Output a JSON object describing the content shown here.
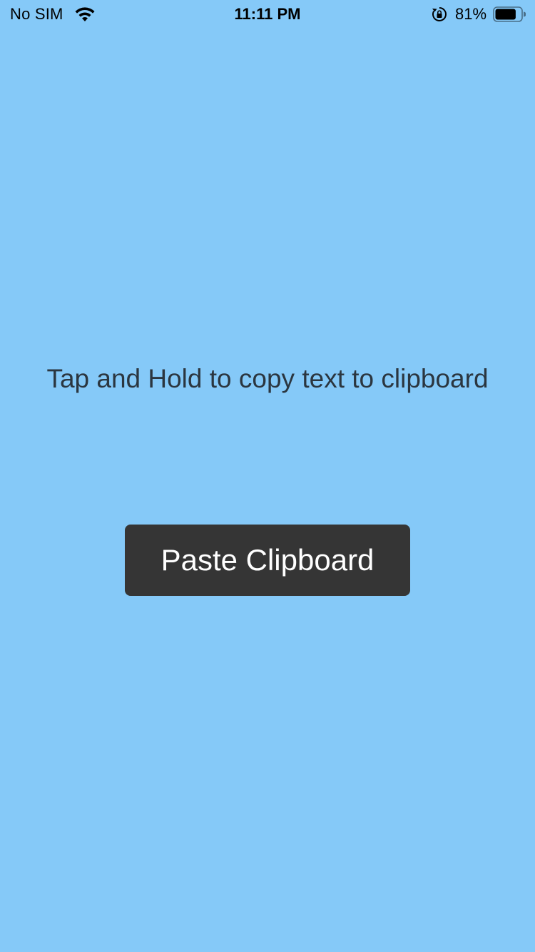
{
  "status_bar": {
    "carrier": "No SIM",
    "time": "11:11 PM",
    "battery_percent": "81%",
    "battery_level": 0.81,
    "icons": {
      "wifi": "wifi-icon",
      "rotation_lock": "rotation-lock-icon",
      "battery": "battery-icon"
    }
  },
  "main": {
    "instruction": "Tap and Hold to copy text to clipboard",
    "paste_button_label": "Paste Clipboard"
  },
  "colors": {
    "background": "#85c9f8",
    "button": "#353535",
    "button_text": "#ffffff",
    "instruction_text": "#2b3640"
  }
}
